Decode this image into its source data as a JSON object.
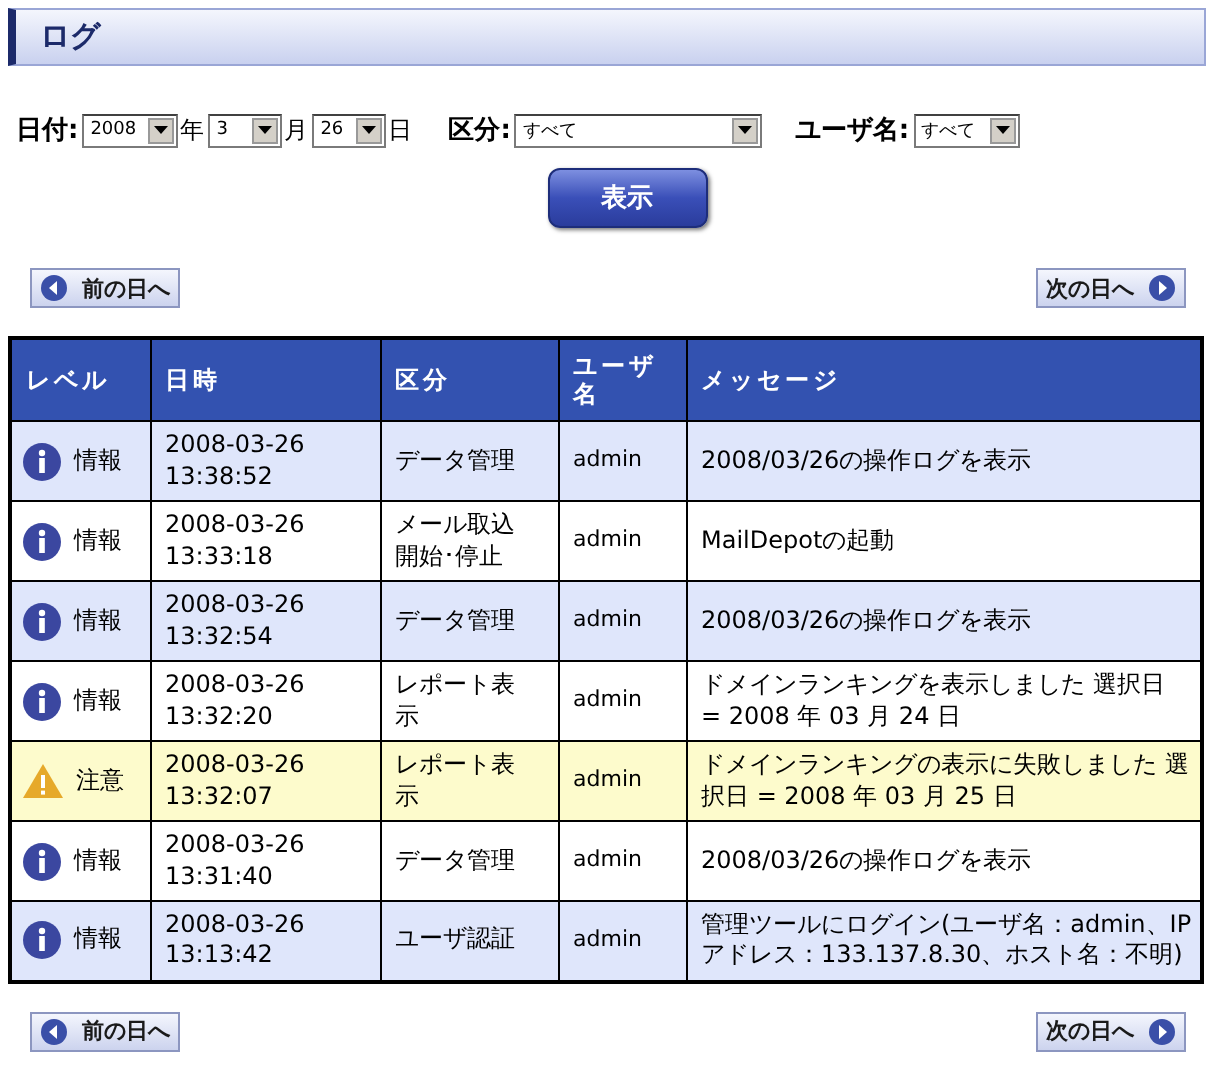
{
  "title": "ログ",
  "filters": [
    {
      "label": "日付:",
      "selects": [
        {
          "value": "2008",
          "suffix": "年"
        },
        {
          "value": "3",
          "suffix": "月"
        },
        {
          "value": "26",
          "suffix": "日"
        }
      ]
    },
    {
      "label": "区分:",
      "selects": [
        {
          "value": "すべて"
        }
      ]
    },
    {
      "label": "ユーザ名:",
      "selects": [
        {
          "value": "すべて"
        }
      ]
    }
  ],
  "show_button": "表示",
  "top_nav": {
    "prev_button": "前の日へ",
    "next_button": "次の日へ"
  },
  "bottom_nav": {
    "prev_button": "前の日へ",
    "next_button": "次の日へ"
  },
  "table": {
    "columns": [
      "レベル",
      "日時",
      "区分",
      "ユーザ名",
      "メッセージ"
    ],
    "rows": [
      {
        "kind": "info",
        "level": "情報",
        "datetime": "2008-03-26 13:38:52",
        "category": "データ管理",
        "user": "admin",
        "message": "2008/03/26の操作ログを表示"
      },
      {
        "kind": "info",
        "level": "情報",
        "datetime": "2008-03-26 13:33:18",
        "category": "メール取込開始･停止",
        "user": "admin",
        "message": "MailDepotの起動"
      },
      {
        "kind": "info",
        "level": "情報",
        "datetime": "2008-03-26 13:32:54",
        "category": "データ管理",
        "user": "admin",
        "message": "2008/03/26の操作ログを表示"
      },
      {
        "kind": "info",
        "level": "情報",
        "datetime": "2008-03-26 13:32:20",
        "category": "レポート表示",
        "user": "admin",
        "message": "ドメインランキングを表示しました 選択日 = 2008 年 03 月 24 日"
      },
      {
        "kind": "warning",
        "level": "注意",
        "datetime": "2008-03-26 13:32:07",
        "category": "レポート表示",
        "user": "admin",
        "message": "ドメインランキングの表示に失敗しました 選択日 = 2008 年 03 月 25 日"
      },
      {
        "kind": "info",
        "level": "情報",
        "datetime": "2008-03-26 13:31:40",
        "category": "データ管理",
        "user": "admin",
        "message": "2008/03/26の操作ログを表示"
      },
      {
        "kind": "info",
        "level": "情報",
        "datetime": "2008-03-26 13:13:42",
        "category": "ユーザ認証",
        "user": "admin",
        "message": "管理ツールにログイン(ユーザ名：admin、IPアドレス：133.137.8.30、ホスト名：不明)"
      }
    ]
  }
}
